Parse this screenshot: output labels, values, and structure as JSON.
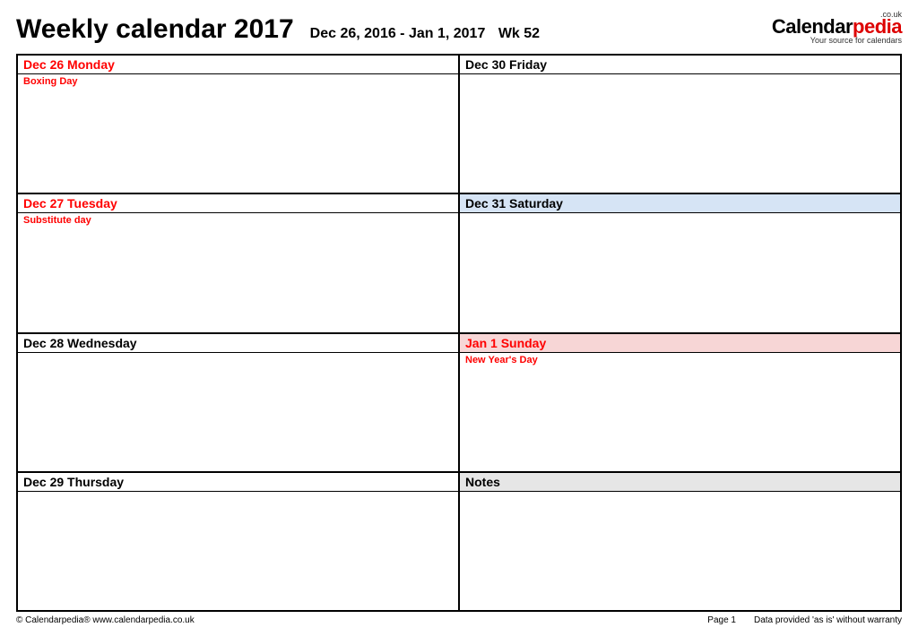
{
  "header": {
    "title": "Weekly calendar 2017",
    "date_range": "Dec 26, 2016 - Jan 1, 2017",
    "week": "Wk 52"
  },
  "brand": {
    "suffix": ".co.uk",
    "name_black": "Calendar",
    "name_red": "pedia",
    "tagline": "Your source for calendars"
  },
  "cells": {
    "c0": {
      "header": "Dec 26  Monday",
      "holiday": "Boxing Day"
    },
    "c1": {
      "header": "Dec 30  Friday",
      "holiday": ""
    },
    "c2": {
      "header": "Dec 27  Tuesday",
      "holiday": "Substitute day"
    },
    "c3": {
      "header": "Dec 31  Saturday",
      "holiday": ""
    },
    "c4": {
      "header": "Dec 28  Wednesday",
      "holiday": ""
    },
    "c5": {
      "header": "Jan 1  Sunday",
      "holiday": "New Year's Day"
    },
    "c6": {
      "header": "Dec 29  Thursday",
      "holiday": ""
    },
    "c7": {
      "header": "Notes",
      "holiday": ""
    }
  },
  "footer": {
    "copyright": "© Calendarpedia®   www.calendarpedia.co.uk",
    "page": "Page 1",
    "disclaimer": "Data provided 'as is' without warranty"
  }
}
